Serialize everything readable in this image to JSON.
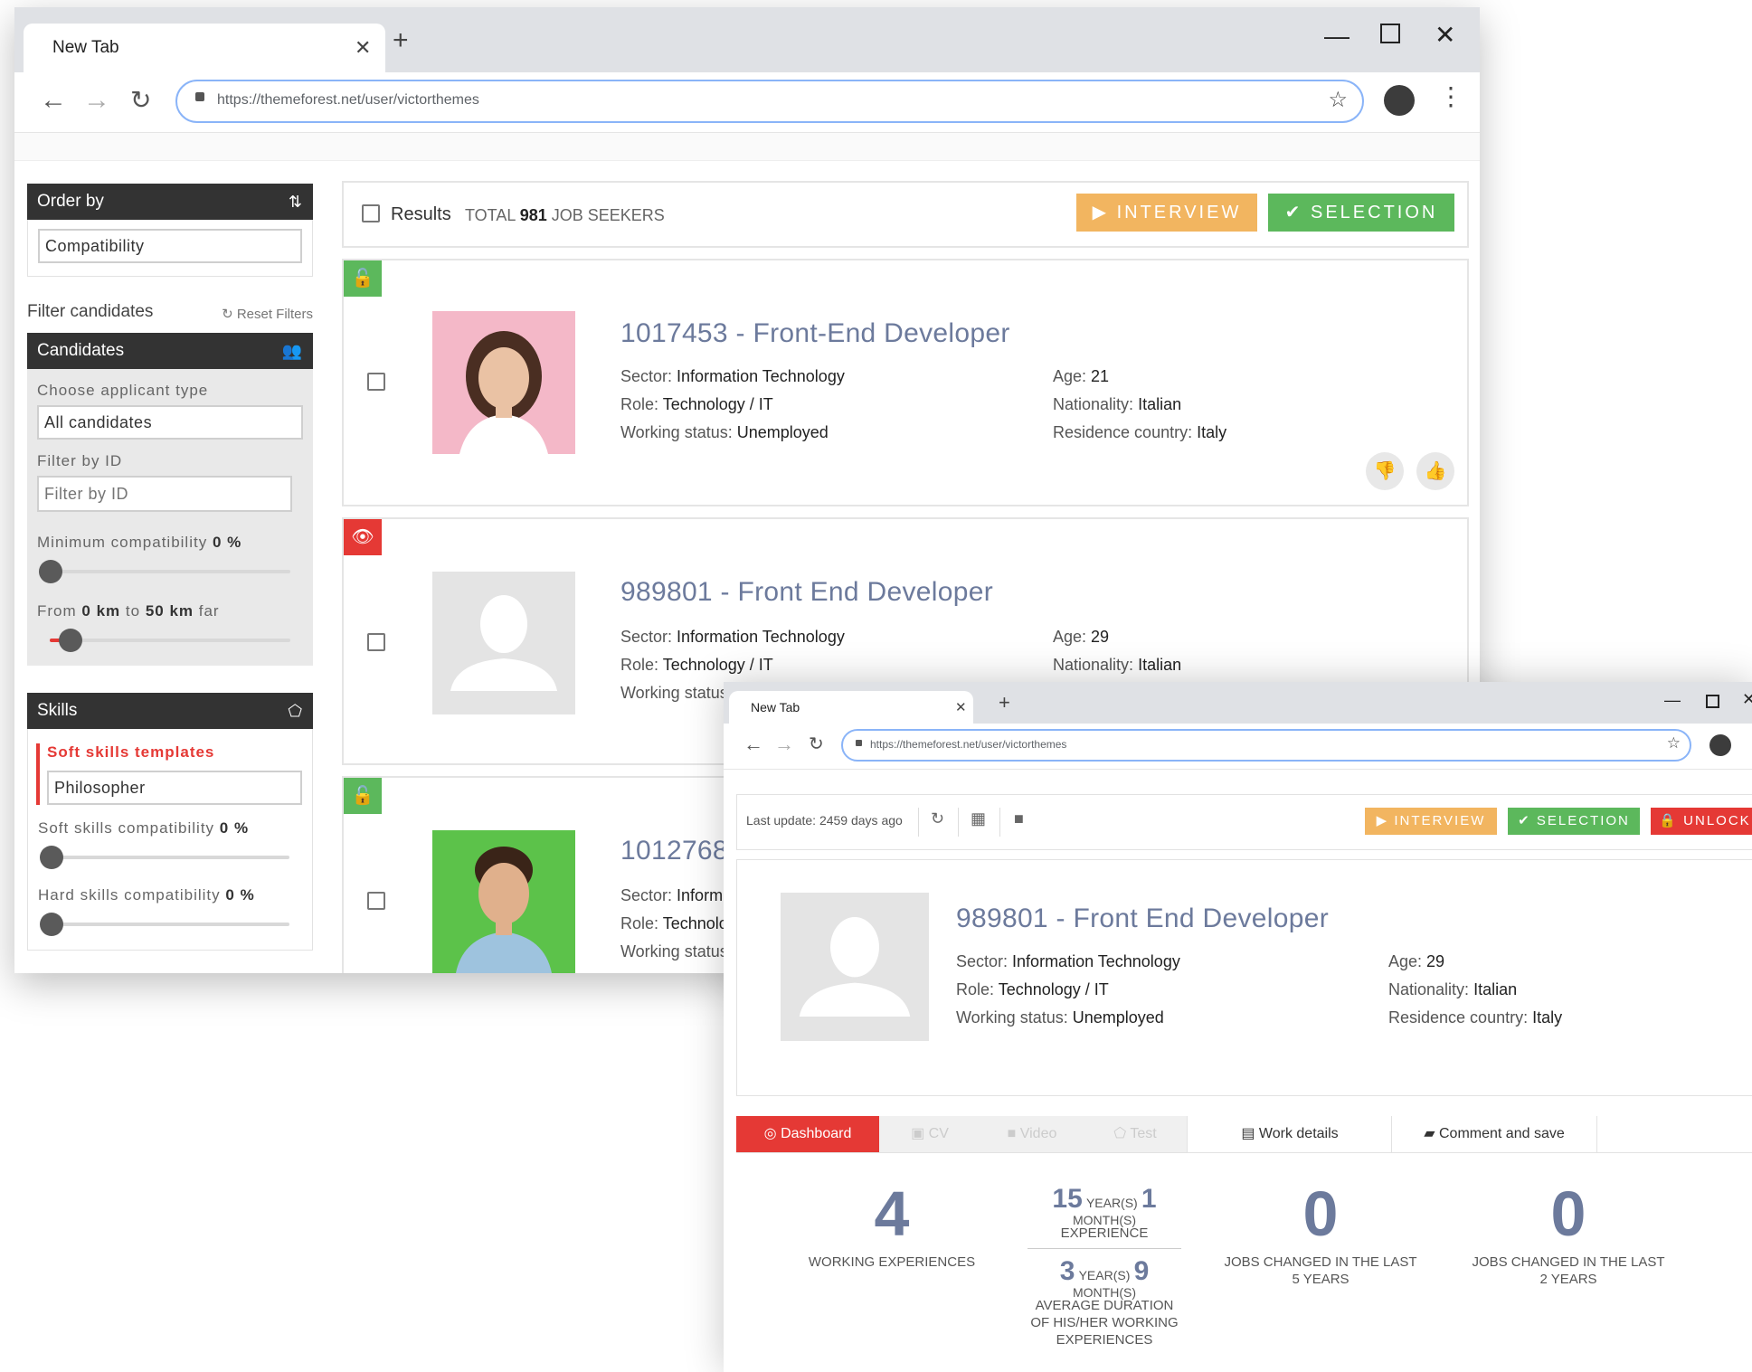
{
  "browser": {
    "tab_title": "New Tab",
    "url": "https://themeforest.net/user/victorthemes"
  },
  "sidebar": {
    "order_by_title": "Order by",
    "order_by_value": "Compatibility",
    "filter_title": "Filter candidates",
    "reset_filters": "Reset Filters",
    "candidates_title": "Candidates",
    "applicant_type_label": "Choose applicant type",
    "applicant_type_value": "All candidates",
    "filter_id_label": "Filter by ID",
    "filter_id_placeholder": "Filter by ID",
    "min_compat_label": "Minimum compatibility",
    "min_compat_value": "0 %",
    "min_compat_level": 0,
    "distance_from_label": "From",
    "distance_from_value": "0 km",
    "distance_to_label": "to",
    "distance_to_value": "50 km",
    "distance_far_label": "far",
    "distance_level": 0.08,
    "skills_title": "Skills",
    "soft_templates_label": "Soft skills templates",
    "soft_templates_value": "Philosopher",
    "soft_compat_label": "Soft skills compatibility",
    "soft_compat_value": "0 %",
    "hard_compat_label": "Hard skills compatibility",
    "hard_compat_value": "0 %"
  },
  "results": {
    "label": "Results",
    "total_prefix": "TOTAL",
    "total_count": "981",
    "total_suffix": "JOB SEEKERS",
    "interview_btn": "INTERVIEW",
    "selection_btn": "SELECTION"
  },
  "labels": {
    "sector": "Sector:",
    "role": "Role:",
    "working_status": "Working status:",
    "age": "Age:",
    "nationality": "Nationality:",
    "residence": "Residence country:"
  },
  "candidates": [
    {
      "title": "1017453 - Front-End Developer",
      "sector": "Information Technology",
      "role": "Technology / IT",
      "status": "Unemployed",
      "age": "21",
      "nationality": "Italian",
      "residence": "Italy"
    },
    {
      "title": "989801 - Front End Developer",
      "sector": "Information Technology",
      "role": "Technology / IT",
      "status": "",
      "age": "29",
      "nationality": "Italian",
      "residence": ""
    },
    {
      "title": "1012768",
      "sector": "Inform",
      "role": "Technolo",
      "status": "",
      "age": "",
      "nationality": "",
      "residence": ""
    }
  ],
  "colors": {
    "orange": "#f2b560",
    "green": "#5cb85c",
    "red": "#e53935",
    "title_blue": "#6c7a9c"
  },
  "detail": {
    "last_update": "Last update: 2459 days ago",
    "interview_btn": "INTERVIEW",
    "selection_btn": "SELECTION",
    "unlock_btn": "UNLOCK",
    "title": "989801 - Front End Developer",
    "sector": "Information Technology",
    "role": "Technology / IT",
    "status": "Unemployed",
    "age": "29",
    "nationality": "Italian",
    "residence": "Italy",
    "tabs": [
      "Dashboard",
      "CV",
      "Video",
      "Test",
      "Work details",
      "Comment and save"
    ],
    "stats": {
      "working_experiences": "4",
      "working_experiences_label": "WORKING EXPERIENCES",
      "exp_years": "15",
      "exp_months": "1",
      "years_unit": "YEAR(S)",
      "months_unit": "MONTH(S)",
      "experience_label": "EXPERIENCE",
      "avg_years": "3",
      "avg_months": "9",
      "avg_label": "AVERAGE DURATION OF HIS/HER WORKING EXPERIENCES",
      "jobs_5": "0",
      "jobs_5_label": "JOBS CHANGED IN THE LAST 5 YEARS",
      "jobs_2": "0",
      "jobs_2_label": "JOBS CHANGED IN THE LAST 2 YEARS"
    }
  }
}
